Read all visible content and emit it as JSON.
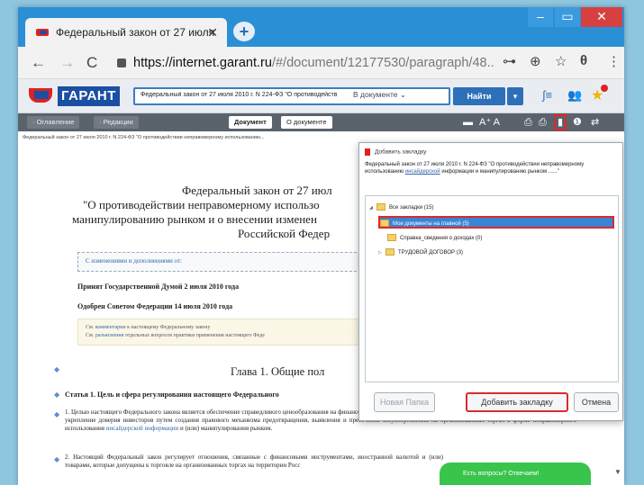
{
  "browser": {
    "tab_title": "Федеральный закон от 27 июля",
    "tab_close": "✕",
    "new_tab": "+",
    "win_min": "–",
    "win_max": "▭",
    "win_close": "✕",
    "back": "←",
    "forward": "→",
    "reload": "C",
    "url_host": "https://internet.garant.ru",
    "url_path": "/#/document/12177530/paragraph/48...",
    "key_icon": "⊶",
    "zoom_icon": "⊕",
    "star_icon": "☆",
    "account_icon": "θ",
    "menu_icon": "⋮"
  },
  "garant": {
    "logo": "ГАРАНТ",
    "search_value": "Федеральный закон от 27 июля 2010 г. N 224-ФЗ \"О противодейств",
    "search_scope": "В документе ⌄",
    "find_button": "Найти",
    "find_dropdown": "▾",
    "formula_icon": "∫≡",
    "users_icon": "👥",
    "star_icon": "★"
  },
  "toolbar": {
    "tab_contents": "· Оглавление",
    "tab_editions": "· Редакции",
    "tab_document": "Документ",
    "tab_about": "О документе",
    "font_icon": "A⁺ A",
    "print_icon": "⎙",
    "bookmark_icon": "▮",
    "info_icon": "❶",
    "arrows_icon": "⇄",
    "kbd_icon": "▬"
  },
  "breadcrumb": "Федеральный закон от 27 июля 2010 г. N 224-ФЗ \"О противодействии неправомерному использованию...",
  "document": {
    "title_line1": "Федеральный закон от 27 июл",
    "title_line2": "\"О противодействии неправомерному использо",
    "title_line3": "манипулированию рынком и о внесении изменен",
    "title_line4": "Российской Федер",
    "changes_link": "С изменениями и дополнениями от:",
    "adopted": "Принят Государственной Думой 2 июля 2010 года",
    "approved": "Одобрен Советом Федерации 14 июля 2010 года",
    "note_line1_pre": "См. ",
    "note_line1_link": "комментарии",
    "note_line1_post": " к настоящему Федеральному закону",
    "note_line2_pre": "См. ",
    "note_line2_link": "разъяснения",
    "note_line2_post": " отдельных вопросов практики применения настоящего Феде",
    "chapter": "Глава 1. Общие пол",
    "article": "Статья 1. Цель и сфера регулирования настоящего Федерального",
    "para1_pre": "1. Целью настоящего Федерального закона является обеспечение справедливого ценообразования на финансовые инструменты, иностранную валюту и (или) товары, равенства инвесторов и укрепление доверия инвесторов путем создания правового механизма предотвращения, выявления и пресечения злоупотреблений на организованных торгах в форме неправомерного использования ",
    "para1_link": "инсайдерской информации",
    "para1_post": " и (или) манипулирования рынком.",
    "para2": "2. Настоящий Федеральный закон регулирует отношения, связанные с финансовыми инструментами, иностранной валютой и (или) товарами, которые допущены к торговле на организованных торгах на территории Росс",
    "bullet": "◆"
  },
  "dialog": {
    "title": "Добавить закладку",
    "desc_pre": "Федеральный закон от 27 июля 2010 г. N 224-ФЗ \"О противодействии неправомерному использованию ",
    "desc_link": "инсайдерской",
    "desc_post": " информации и манипулированию рынком ......\"",
    "root": "Все закладки (15)",
    "item1": "Мои документы на главной (5)",
    "item2": "Справка_сведения о доходах (0)",
    "item3": "ТРУДОВОЙ ДОГОВОР (3)",
    "expand": "◢",
    "collapsed": "▷",
    "new_folder": "Новая Папка",
    "add": "Добавить закладку",
    "cancel": "Отмена"
  },
  "chat": {
    "label": "Есть вопросы? Отвечаем!"
  },
  "scroll_down": "▼"
}
